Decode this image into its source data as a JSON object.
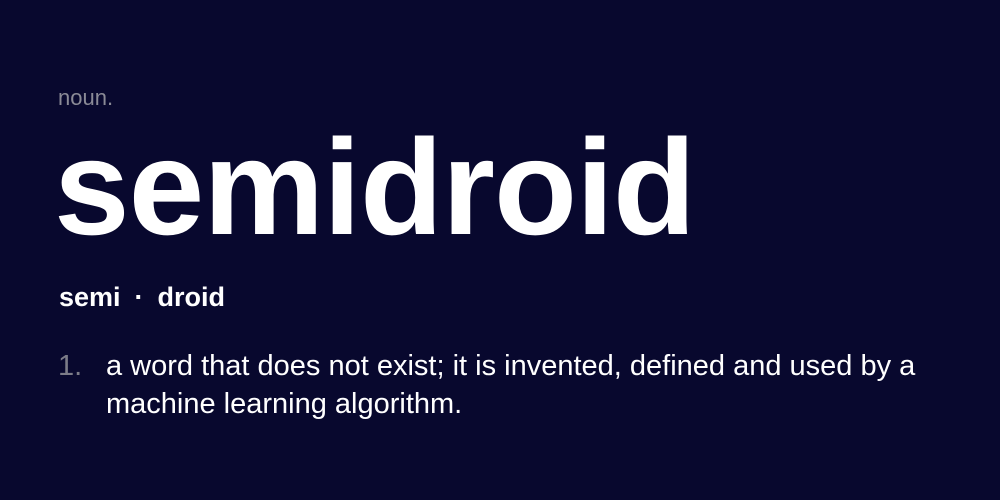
{
  "entry": {
    "part_of_speech": "noun.",
    "word": "semidroid",
    "syllables": [
      "semi",
      "droid"
    ],
    "separator": "·",
    "definitions": [
      {
        "number": "1.",
        "text": "a word that does not exist; it is invented, defined and used by a machine learning algorithm."
      }
    ]
  },
  "colors": {
    "background": "#08082e",
    "text": "#ffffff",
    "muted": "#8a8a96"
  }
}
